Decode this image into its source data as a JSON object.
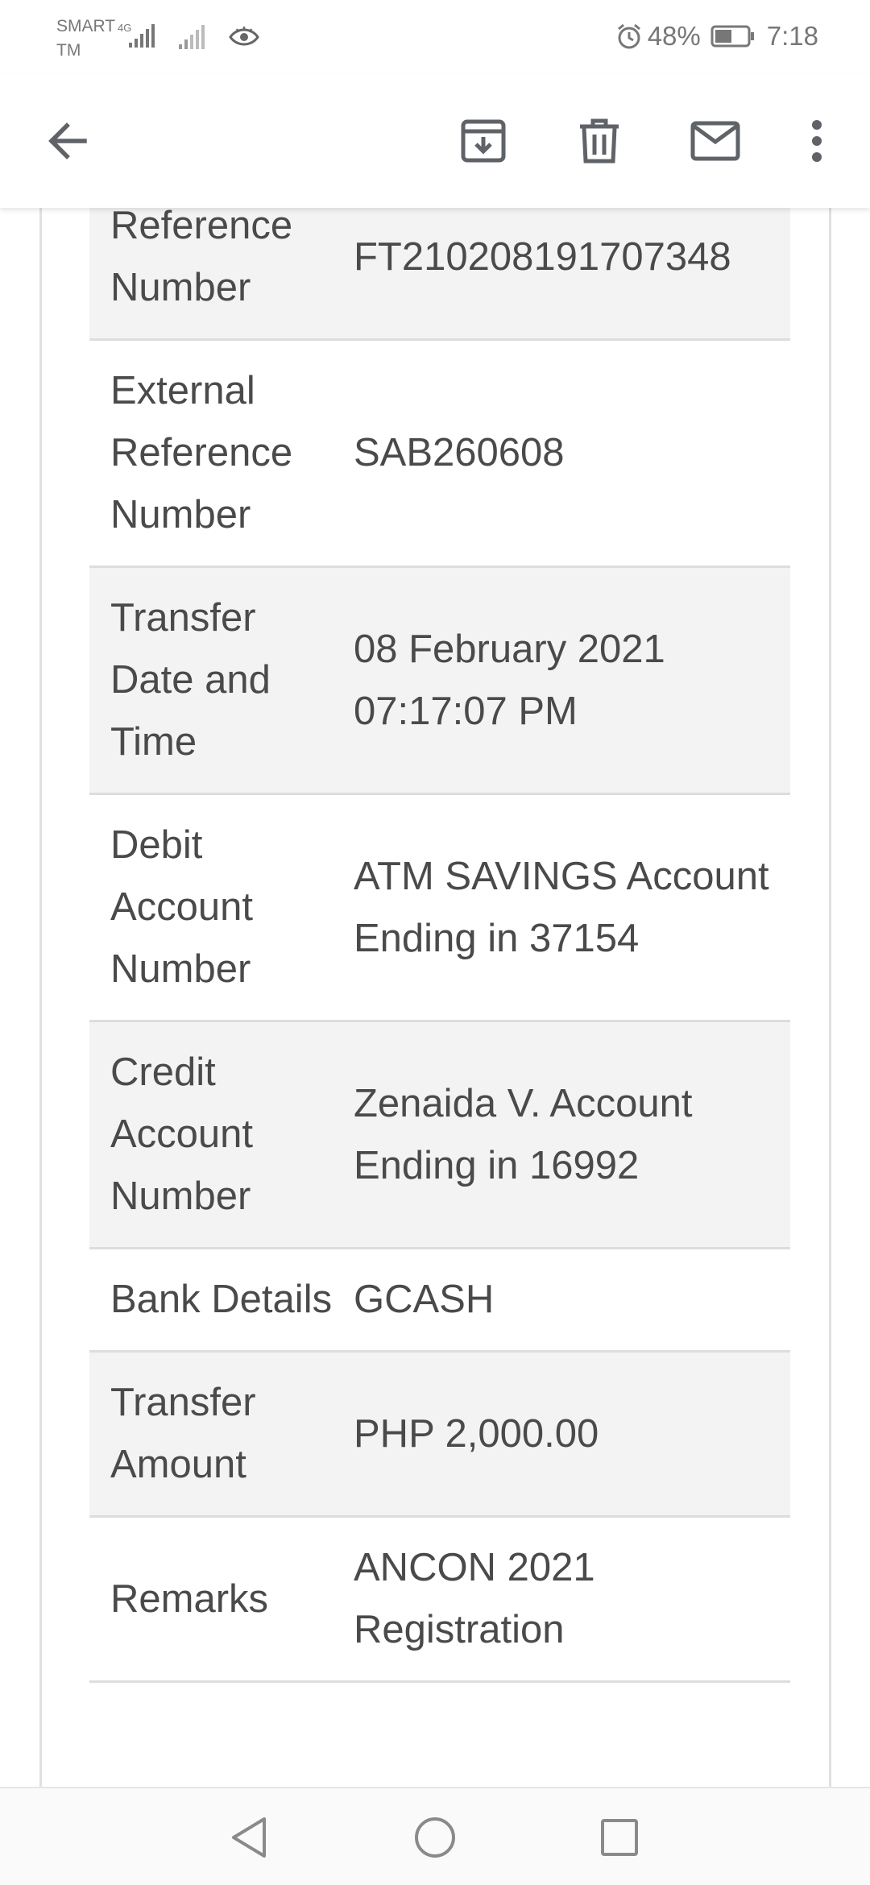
{
  "status_bar": {
    "carrier": "SMART TM",
    "network": "4G",
    "battery": "48%",
    "time": "7:18",
    "icons": [
      "signal-icon",
      "eye-icon",
      "alarm-icon",
      "battery-icon"
    ]
  },
  "app_bar": {
    "icons": [
      "back-arrow-icon",
      "archive-icon",
      "delete-icon",
      "mark-unread-icon",
      "more-vert-icon"
    ]
  },
  "transaction": {
    "rows": [
      {
        "label": "Reference Number",
        "value": "FT210208191707348"
      },
      {
        "label": "External Reference Number",
        "value": "SAB260608"
      },
      {
        "label": "Transfer Date and Time",
        "value": "08 February 2021 07:17:07 PM"
      },
      {
        "label": "Debit Account Number",
        "value": "ATM SAVINGS Account Ending in 37154"
      },
      {
        "label": "Credit Account Number",
        "value": "Zenaida V. Account Ending in 16992"
      },
      {
        "label": "Bank Details",
        "value": "GCASH"
      },
      {
        "label": "Transfer Amount",
        "value": "PHP 2,000.00"
      },
      {
        "label": "Remarks",
        "value": "ANCON 2021 Registration"
      }
    ]
  },
  "nav_bar": {
    "icons": [
      "nav-back-icon",
      "nav-home-icon",
      "nav-recents-icon"
    ]
  },
  "colors": {
    "row_shade": "#f3f3f3",
    "divider": "#dddddd",
    "text": "#4a4a4a",
    "icon": "#5f6368"
  }
}
